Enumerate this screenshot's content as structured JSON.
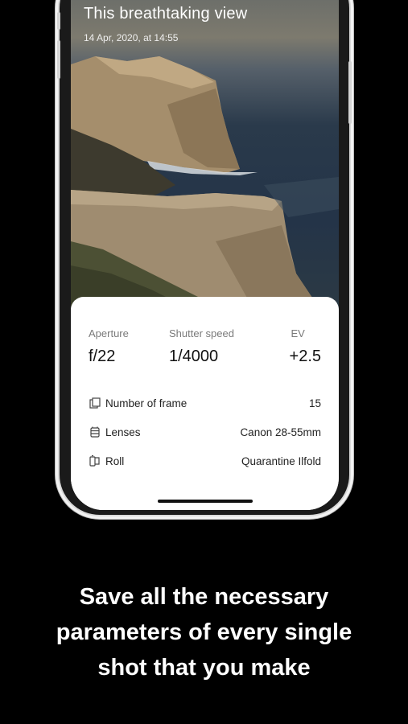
{
  "photo": {
    "title": "This breathtaking view",
    "date": "14 Apr, 2020, at 14:55"
  },
  "stats": [
    {
      "label": "Aperture",
      "value": "f/22"
    },
    {
      "label": "Shutter speed",
      "value": "1/4000"
    },
    {
      "label": "EV",
      "value": "+2.5"
    }
  ],
  "details": [
    {
      "icon": "frame-icon",
      "label": "Number of frame",
      "value": "15"
    },
    {
      "icon": "lens-icon",
      "label": "Lenses",
      "value": "Canon 28-55mm"
    },
    {
      "icon": "film-roll-icon",
      "label": "Roll",
      "value": "Quarantine Ilfold"
    }
  ],
  "caption": [
    "Save all the necessary",
    "parameters of every single",
    "shot that you make"
  ]
}
